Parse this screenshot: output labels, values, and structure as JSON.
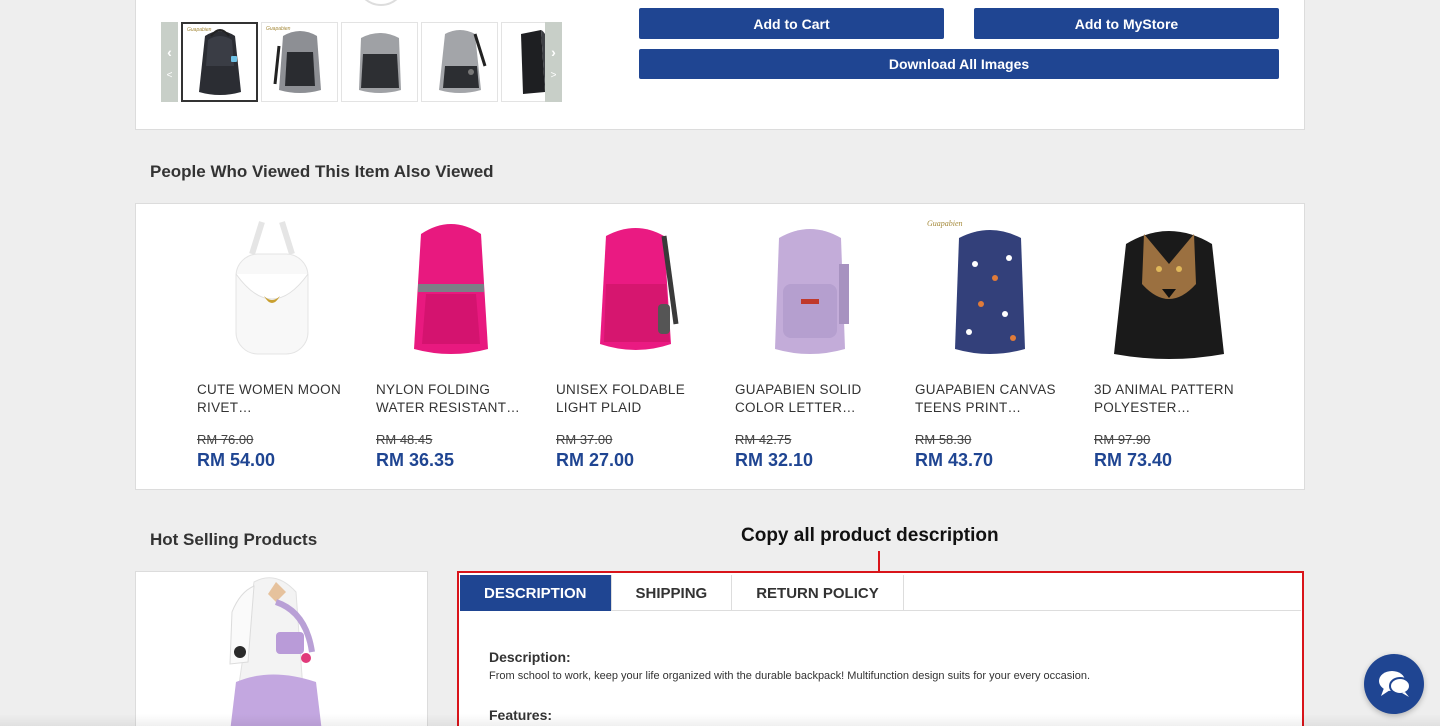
{
  "product": {
    "buttons": {
      "add_to_cart": "Add to Cart",
      "add_to_mystore": "Add to MyStore",
      "download_images": "Download All Images"
    },
    "thumbnail_logo": "Guapabien",
    "thumb_nav": {
      "prev": "‹",
      "prev_small": "<",
      "next": "›",
      "next_small": ">"
    }
  },
  "viewed": {
    "title": "People Who Viewed This Item Also Viewed",
    "items": [
      {
        "name": "CUTE WOMEN MOON RIVET…",
        "old_price": "RM 76.00",
        "price": "RM 54.00",
        "color": "#ffffff"
      },
      {
        "name": "NYLON FOLDING WATER RESISTANT…",
        "old_price": "RM 48.45",
        "price": "RM 36.35",
        "color": "#e8197f"
      },
      {
        "name": "UNISEX FOLDABLE LIGHT PLAID PATTER…",
        "old_price": "RM 37.00",
        "price": "RM 27.00",
        "color": "#ea1a82"
      },
      {
        "name": "GUAPABIEN SOLID COLOR LETTER…",
        "old_price": "RM 42.75",
        "price": "RM 32.10",
        "color": "#c3acd9"
      },
      {
        "name": "GUAPABIEN CANVAS TEENS PRINT…",
        "old_price": "RM 58.30",
        "price": "RM 43.70",
        "color": "#33407a"
      },
      {
        "name": "3D ANIMAL PATTERN POLYESTER…",
        "old_price": "RM 97.90",
        "price": "RM 73.40",
        "color": "#1a1a1a"
      }
    ],
    "item_logo": "Guapabien"
  },
  "hot_selling": {
    "title": "Hot Selling Products"
  },
  "callout": {
    "text": "Copy all product description"
  },
  "description": {
    "tabs": [
      "DESCRIPTION",
      "SHIPPING",
      "RETURN POLICY"
    ],
    "active_tab": 0,
    "heading": "Description:",
    "text": "From school to work, keep your life organized with the durable backpack! Multifunction design suits for your every occasion.",
    "features_heading": "Features:"
  },
  "colors": {
    "brand_blue": "#1f4592",
    "highlight_red": "#d9141a"
  }
}
